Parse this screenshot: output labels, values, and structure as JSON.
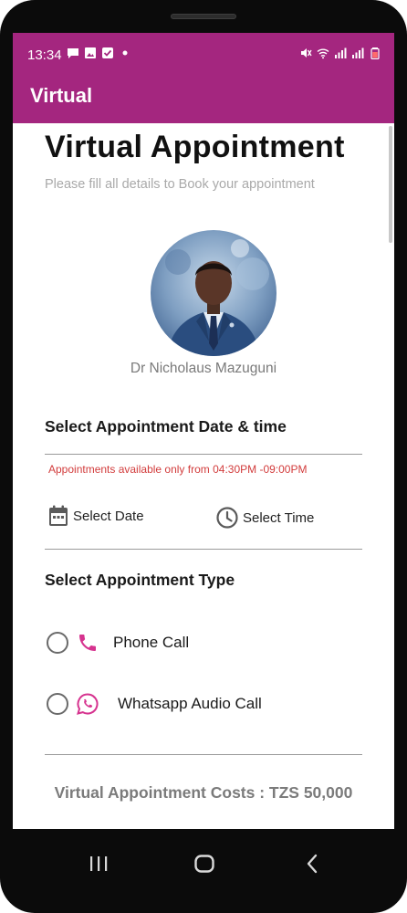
{
  "status_bar": {
    "time": "13:34",
    "background": "#a4267f"
  },
  "app_bar": {
    "title": "Virtual"
  },
  "header": {
    "title": "Virtual Appointment",
    "subtitle": "Please fill all details to Book your appointment"
  },
  "doctor": {
    "name": "Dr Nicholaus Mazuguni"
  },
  "schedule": {
    "section_title": "Select Appointment Date & time",
    "availability_notice": "Appointments available only from 04:30PM -09:00PM",
    "date_label": "Select Date",
    "time_label": "Select Time"
  },
  "appointment_type": {
    "section_title": "Select Appointment Type",
    "options": [
      {
        "label": "Phone Call",
        "icon": "phone-icon",
        "selected": false
      },
      {
        "label": "Whatsapp Audio Call",
        "icon": "whatsapp-icon",
        "selected": false
      }
    ]
  },
  "cost": {
    "text": "Virtual Appointment Costs : TZS 50,000"
  },
  "colors": {
    "primary": "#a4267f",
    "accent_pink": "#d6338f",
    "notice_red": "#d23c3c"
  },
  "nav_bar": {
    "buttons": [
      "recents-icon",
      "home-icon",
      "back-icon"
    ]
  }
}
